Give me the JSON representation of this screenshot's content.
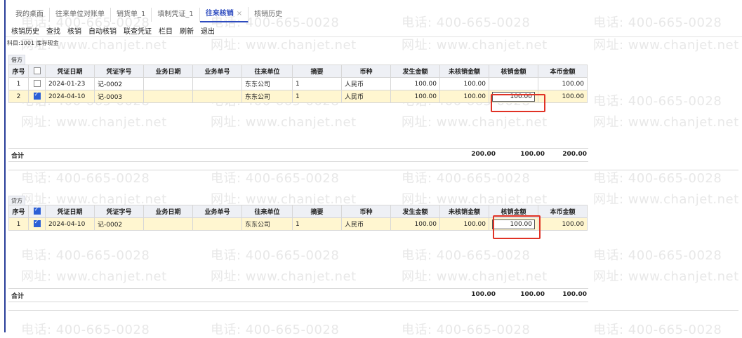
{
  "tabs": [
    {
      "label": "我的桌面"
    },
    {
      "label": "往来单位对账单"
    },
    {
      "label": "销货单_1"
    },
    {
      "label": "填制凭证_1"
    },
    {
      "label": "往来核销",
      "close": "×"
    },
    {
      "label": "核销历史"
    }
  ],
  "toolbar": [
    "核销历史",
    "查找",
    "核销",
    "自动核销",
    "联查凭证",
    "栏目",
    "刷新",
    "退出"
  ],
  "subject": "科目:1001 库存现金",
  "watermark": {
    "phone": "电话: 400-665-0028",
    "url": "网址: www.chanjet.net"
  },
  "columns": [
    "序号",
    "",
    "凭证日期",
    "凭证字号",
    "业务日期",
    "业务单号",
    "往来单位",
    "摘要",
    "币种",
    "发生金额",
    "未核销金额",
    "核销金额",
    "本币金额"
  ],
  "debit": {
    "label": "借方",
    "rows": [
      {
        "no": "1",
        "checked": false,
        "date": "2024-01-23",
        "voucher": "记-0002",
        "biz_date": "",
        "biz_no": "",
        "unit": "东东公司",
        "summary": "1",
        "currency": "人民币",
        "amount": "100.00",
        "unverified": "100.00",
        "verify": "",
        "base": "100.00"
      },
      {
        "no": "2",
        "checked": true,
        "date": "2024-04-10",
        "voucher": "记-0003",
        "biz_date": "",
        "biz_no": "",
        "unit": "东东公司",
        "summary": "1",
        "currency": "人民币",
        "amount": "100.00",
        "unverified": "100.00",
        "verify": "100.00",
        "base": "100.00"
      }
    ],
    "total": {
      "label": "合计",
      "unverified": "200.00",
      "verify": "100.00",
      "base": "200.00"
    }
  },
  "credit": {
    "label": "贷方",
    "rows": [
      {
        "no": "1",
        "checked": true,
        "date": "2024-04-10",
        "voucher": "记-0002",
        "biz_date": "",
        "biz_no": "",
        "unit": "东东公司",
        "summary": "1",
        "currency": "人民币",
        "amount": "100.00",
        "unverified": "100.00",
        "verify": "100.00",
        "base": "100.00"
      }
    ],
    "total": {
      "label": "合计",
      "unverified": "100.00",
      "verify": "100.00",
      "base": "100.00"
    }
  },
  "colors": {
    "accent": "#2d4bbf",
    "selected_row": "#fff6d0",
    "highlight": "#e03225"
  }
}
